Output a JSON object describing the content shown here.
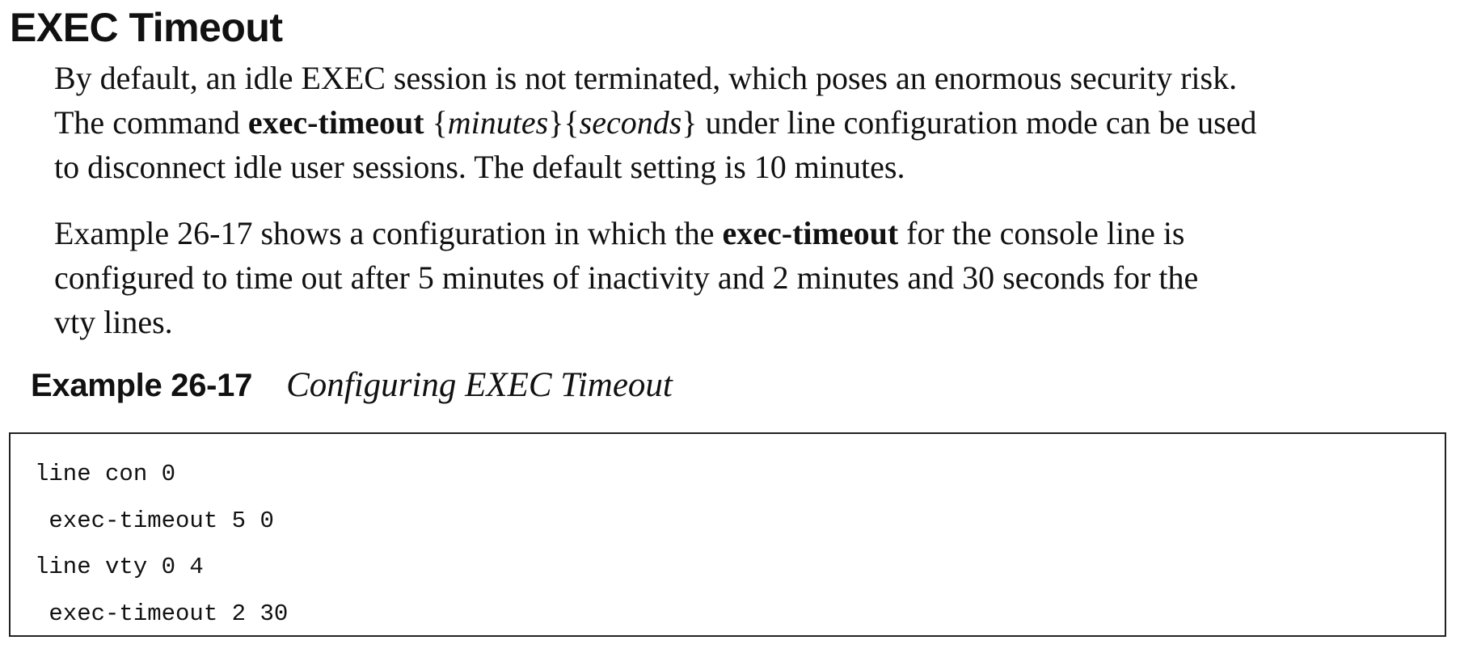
{
  "section": {
    "heading": "EXEC Timeout"
  },
  "paragraph1": {
    "lines": [
      {
        "segments": [
          {
            "text": "By default, an idle EXEC session is not terminated, which poses an enormous security risk."
          }
        ]
      },
      {
        "segments": [
          {
            "text": "The command "
          },
          {
            "text": "exec-timeout",
            "style": "bold"
          },
          {
            "text": " {"
          },
          {
            "text": "minutes",
            "style": "italic"
          },
          {
            "text": "}{"
          },
          {
            "text": "seconds",
            "style": "italic"
          },
          {
            "text": "} under line configuration mode can be used"
          }
        ]
      },
      {
        "segments": [
          {
            "text": "to disconnect idle user sessions. The default setting is 10 minutes."
          }
        ]
      }
    ]
  },
  "paragraph2": {
    "lines": [
      {
        "segments": [
          {
            "text": "Example 26-17 shows a configuration in which the "
          },
          {
            "text": "exec-timeout",
            "style": "bold"
          },
          {
            "text": " for the console line is"
          }
        ]
      },
      {
        "segments": [
          {
            "text": "configured to time out after 5 minutes of inactivity and 2 minutes and 30 seconds for the"
          }
        ]
      },
      {
        "segments": [
          {
            "text": "vty lines."
          }
        ]
      }
    ]
  },
  "example": {
    "label": "Example 26-17",
    "title": "Configuring EXEC Timeout",
    "code_lines": [
      "line con 0",
      " exec-timeout 5 0",
      "line vty 0 4",
      " exec-timeout 2 30"
    ]
  }
}
